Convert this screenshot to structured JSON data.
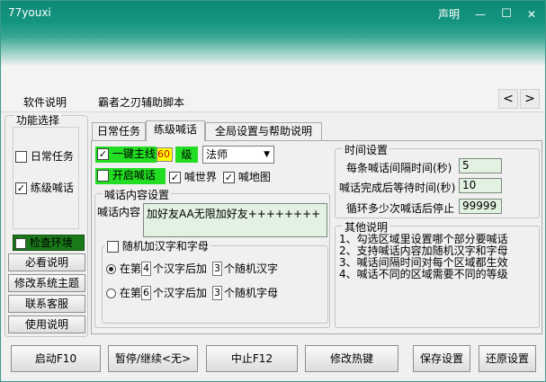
{
  "window": {
    "title": "77youxi",
    "statement": "声明",
    "min_glyph": "—",
    "max_glyph": "☐",
    "close_glyph": "✕"
  },
  "menu": {
    "items": [
      "软件说明",
      "霸者之刃辅助脚本"
    ],
    "prev": "<",
    "next": ">"
  },
  "left": {
    "group_title": "功能选择",
    "daily_task": "日常任务",
    "practice_shout": "练级喊话",
    "check_env": "检查环境",
    "buttons": [
      "必看说明",
      "修改系统主题",
      "联系客服",
      "使用说明"
    ]
  },
  "tabs": [
    "日常任务",
    "练级喊话",
    "全局设置与帮助说明"
  ],
  "shout": {
    "main_line_label": "一键主线",
    "main_line_level": "60",
    "level_unit": "级",
    "class_value": "法师",
    "open_shout": "开启喊话",
    "shout_world": "喊世界",
    "shout_map": "喊地图",
    "content_group": "喊话内容设置",
    "content_label": "喊话内容",
    "content_value": "加好友AA无限加好友++++++++",
    "random_label": "随机加汉字和字母",
    "r1_prefix": "在第",
    "r1_n": "4",
    "r1_mid": "个汉字后加",
    "r1_m": "3",
    "r1_suffix": "个随机汉字",
    "r2_prefix": "在第",
    "r2_n": "6",
    "r2_mid": "个汉字后加",
    "r2_m": "3",
    "r2_suffix": "个随机字母"
  },
  "time": {
    "group": "时间设置",
    "interval_label": "每条喊话间隔时间(秒)",
    "interval_value": "5",
    "wait_label": "喊话完成后等待时间(秒)",
    "wait_value": "10",
    "loop_label": "循环多少次喊话后停止",
    "loop_value": "99999"
  },
  "other": {
    "group": "其他说明",
    "lines": [
      "1、勾选区域里设置哪个部分要喊话",
      "2、支持喊话内容加随机汉字和字母",
      "3、喊话间隔时间对每个区域都生效",
      "4、喊话不同的区域需要不同的等级"
    ]
  },
  "bottom_buttons": [
    "启动F10",
    "暂停/继续<无>",
    "中止F12",
    "修改热键",
    "保存设置",
    "还原设置"
  ],
  "colors": {
    "title_teal": "#14957f",
    "highlight_green": "#22dd22",
    "level_yellow": "#ffff00",
    "input_green": "#e2f1e2"
  }
}
